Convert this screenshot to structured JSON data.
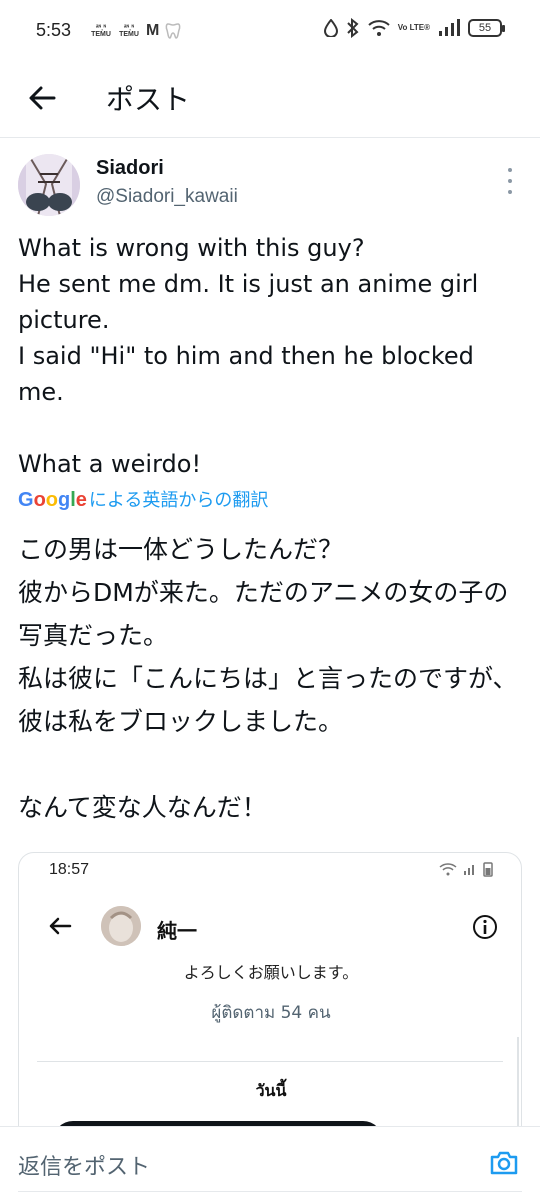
{
  "status_bar": {
    "time": "5:53",
    "app_logos": [
      "ᵃᶰ˳ᶰ TEMU",
      "ᵃᶰ˳ᶰ TEMU"
    ],
    "m_label": "M",
    "volte": "Vo LTE®",
    "battery": "55"
  },
  "header": {
    "title": "ポスト"
  },
  "author": {
    "name": "Siadori",
    "handle": "@Siadori_kawaii"
  },
  "tweet": {
    "text": "What is wrong with this guy?\nHe sent me dm. It is just an anime girl picture.\nI said \"Hi\" to him and then he blocked me.\n\nWhat a weirdo!",
    "translate_label": "による英語からの翻訳",
    "translated_text": "この男は一体どうしたんだ？\n彼からDMが来た。ただのアニメの女の子の写真だった。\n私は彼に「こんにちは」と言ったのですが、彼は私をブロックしました。\n\nなんて変な人なんだ！"
  },
  "embedded_screenshot": {
    "time": "18:57",
    "name": "純一",
    "greeting": "よろしくお願いします。",
    "followers": "ผู้ติดตาม 54 คน",
    "today": "วันนี้"
  },
  "reply_bar": {
    "placeholder": "返信をポスト"
  },
  "colors": {
    "accent": "#1d9bf0",
    "text": "#0f1419",
    "secondary_text": "#536471",
    "divider": "#e6e9ec"
  },
  "icons": [
    "back-arrow-icon",
    "more-vertical-icon",
    "camera-icon",
    "info-icon",
    "wifi-icon",
    "signal-icon",
    "bluetooth-icon",
    "water-drop-icon"
  ]
}
